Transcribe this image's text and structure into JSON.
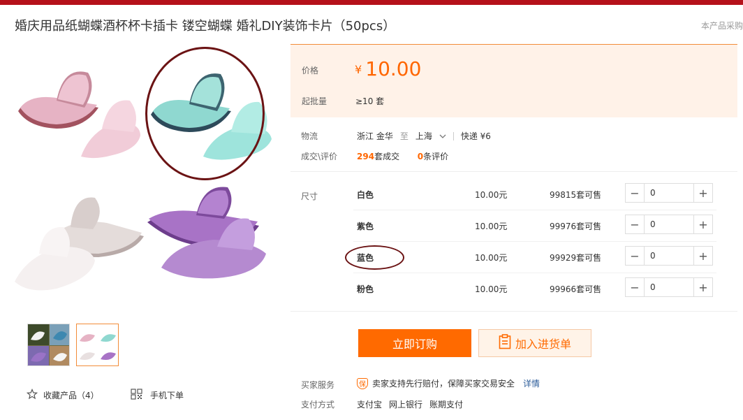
{
  "header": {
    "title": "婚庆用品纸蝴蝶酒杯杯卡插卡 镂空蝴蝶 婚礼DIY装饰卡片（50pcs）",
    "side_note": "本产品采购"
  },
  "gallery": {
    "colors": {
      "pink": "#e8b8c8",
      "pink_dark": "#a2525f",
      "teal": "#8fd8d0",
      "teal_dark": "#2d4a5a",
      "white": "#f2ecec",
      "white_dark": "#b8aaa8",
      "purple": "#a873c6",
      "purple_dark": "#6d3d8c",
      "ring": "#6b1314"
    }
  },
  "actions": {
    "favorite_icon": "star-outline-icon",
    "favorite_label": "收藏产品（4）",
    "mobile_icon": "qr-code-icon",
    "mobile_label": "手机下单"
  },
  "pricing": {
    "price_label": "价格",
    "currency": "¥",
    "price": "10.00",
    "moq_label": "起批量",
    "moq_value": "≥10 套"
  },
  "logistics": {
    "label": "物流",
    "origin": "浙江 金华",
    "to": "至",
    "destination": "上海",
    "shipping": "快递 ¥6"
  },
  "deals": {
    "label": "成交\\评价",
    "sold_count": "294",
    "sold_suffix": "套成交",
    "review_count": "0",
    "review_suffix": "条评价"
  },
  "sku": {
    "label": "尺寸",
    "rows": [
      {
        "name": "白色",
        "price": "10.00元",
        "stock": "99815套可售",
        "qty": "0"
      },
      {
        "name": "紫色",
        "price": "10.00元",
        "stock": "99976套可售",
        "qty": "0"
      },
      {
        "name": "蓝色",
        "price": "10.00元",
        "stock": "99929套可售",
        "qty": "0"
      },
      {
        "name": "粉色",
        "price": "10.00元",
        "stock": "99966套可售",
        "qty": "0"
      }
    ]
  },
  "buttons": {
    "buy_now": "立即订购",
    "add_to_cart": "加入进货单",
    "cart_icon": "clipboard-icon"
  },
  "service": {
    "label": "买家服务",
    "badge": "保",
    "text": "卖家支持先行赔付，保障买家交易安全",
    "link": "详情"
  },
  "payment": {
    "label": "支付方式",
    "methods": [
      "支付宝",
      "网上银行",
      "账期支付"
    ]
  },
  "theme": {
    "accent": "#ff6a00",
    "top_bar": "#b5111a",
    "price_bg": "#fff2e8"
  }
}
